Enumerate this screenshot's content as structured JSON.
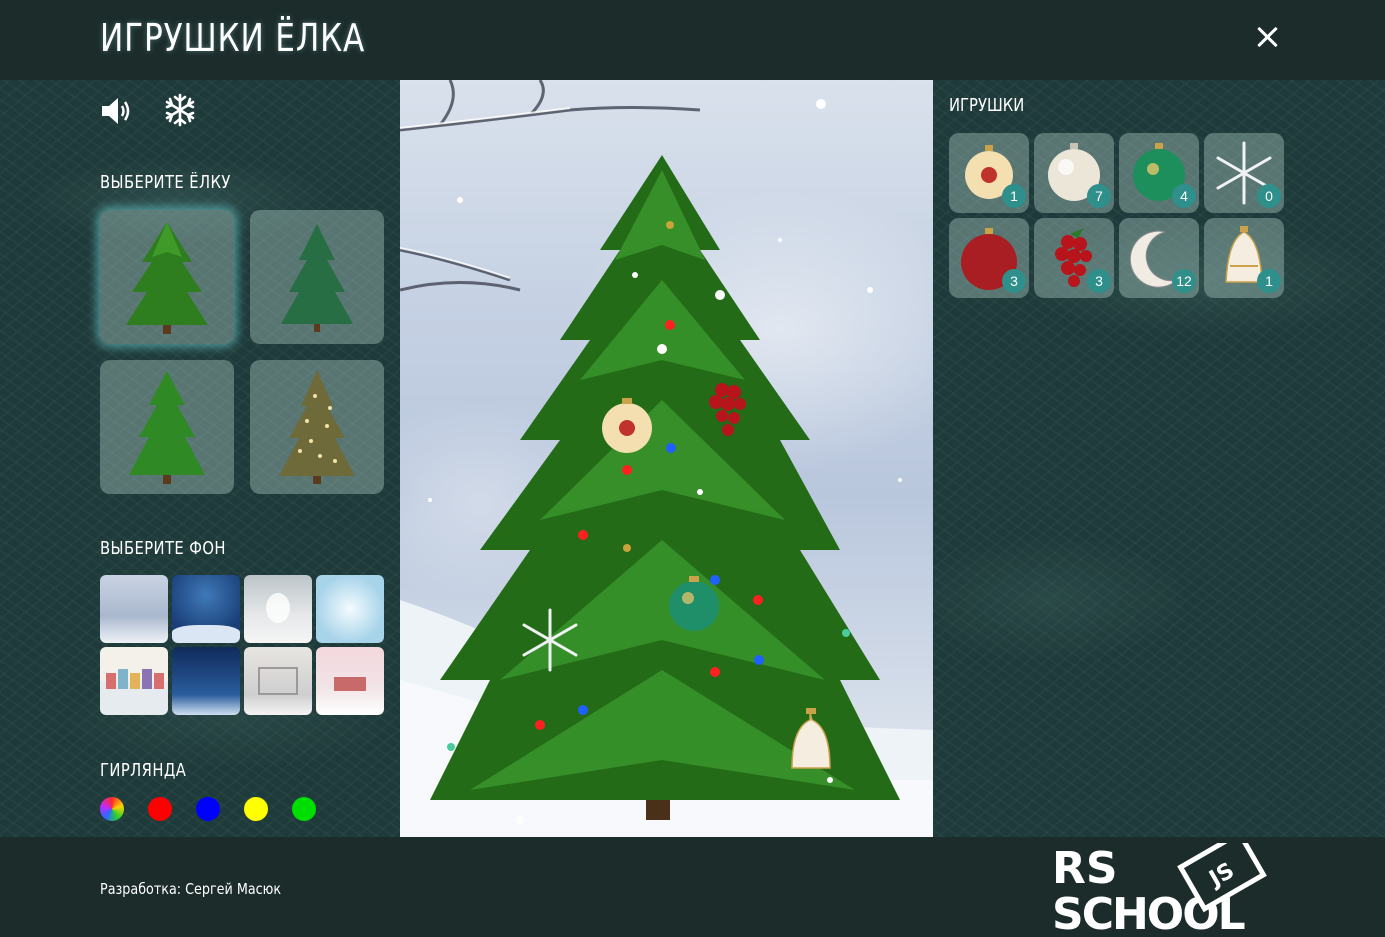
{
  "header": {
    "title": "ИГРУШКИ ЁЛКА",
    "close_icon": "close-icon"
  },
  "controls": {
    "sound_icon": "speaker-icon",
    "snow_icon": "snowflake-icon"
  },
  "tree_section": {
    "title": "ВЫБЕРИТЕ ЁЛКУ",
    "selected_index": 0,
    "items": [
      "tree-1",
      "tree-2",
      "tree-3",
      "tree-4"
    ]
  },
  "background_section": {
    "title": "ВЫБЕРИТЕ ФОН",
    "items": [
      "bg-1",
      "bg-2",
      "bg-3",
      "bg-4",
      "bg-5",
      "bg-6",
      "bg-7",
      "bg-8"
    ]
  },
  "garland_section": {
    "title": "ГИРЛЯНДА",
    "colors": [
      {
        "name": "multicolor",
        "color": "multi"
      },
      {
        "name": "red",
        "color": "#ff0000"
      },
      {
        "name": "blue",
        "color": "#0000ff"
      },
      {
        "name": "yellow",
        "color": "#ffff00"
      },
      {
        "name": "green",
        "color": "#00dd00"
      }
    ]
  },
  "toys_section": {
    "title": "ИГРУШКИ",
    "items": [
      {
        "name": "gold-ball",
        "count": "1"
      },
      {
        "name": "white-ball",
        "count": "7"
      },
      {
        "name": "green-ball",
        "count": "4"
      },
      {
        "name": "snowflake-toy",
        "count": "0"
      },
      {
        "name": "red-ball",
        "count": "3"
      },
      {
        "name": "grapes-toy",
        "count": "3"
      },
      {
        "name": "crescent-toy",
        "count": "12"
      },
      {
        "name": "bell-toy",
        "count": "1"
      }
    ]
  },
  "footer": {
    "credit": "Разработка: Сергей Масюк",
    "logo_text_top": "RS",
    "logo_text_bottom": "SCHOOL",
    "logo_badge": "JS"
  },
  "colors": {
    "page_bg": "#1b2c2b",
    "panel_card": "#8fa9a5",
    "badge": "#2f8f8a",
    "active_glow": "#78e6e6"
  }
}
